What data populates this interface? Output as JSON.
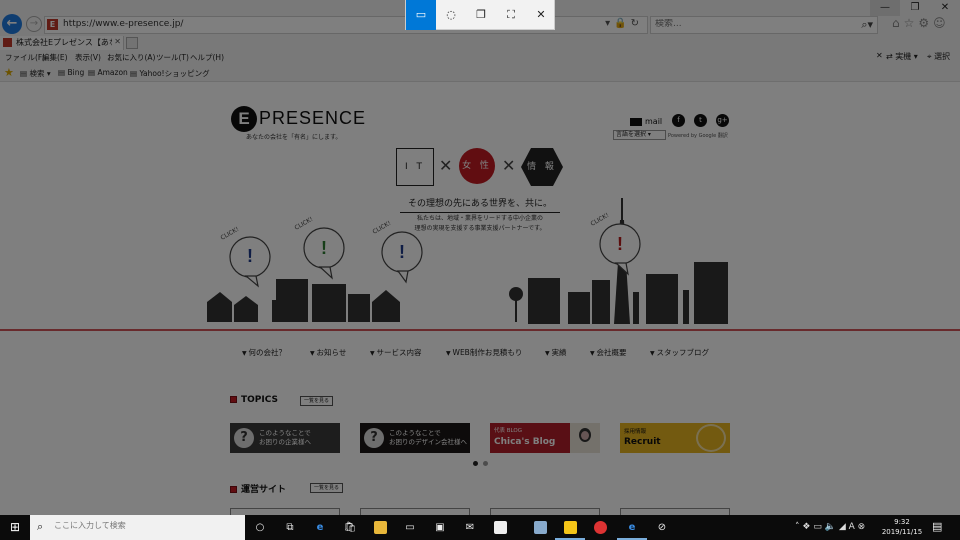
{
  "browser": {
    "url": "https://www.e-presence.jp/",
    "search_placeholder": "検索...",
    "tab_title": "株式会社Eプレゼンス【あなたの...",
    "menu": [
      "ファイル(F)",
      "編集(E)",
      "表示(V)",
      "お気に入り(A)",
      "ツール(T)",
      "ヘルプ(H)"
    ],
    "menu_right": [
      "実機",
      "選択"
    ],
    "favorites": [
      "検索",
      "Bing",
      "Amazon",
      "Yahoo!ショッピング"
    ]
  },
  "snip_toolbar": {
    "buttons": [
      {
        "name": "rectangular-snip",
        "icon": "▭",
        "active": true
      },
      {
        "name": "freeform-snip",
        "icon": "◌",
        "active": false
      },
      {
        "name": "window-snip",
        "icon": "❐",
        "active": false
      },
      {
        "name": "fullscreen-snip",
        "icon": "⛶",
        "active": false
      },
      {
        "name": "close",
        "icon": "✕",
        "active": false
      }
    ]
  },
  "site": {
    "logo_letter": "E",
    "logo_text": "PRESENCE",
    "logo_sub": "あなたの会社を「有名」にします。",
    "mail_label": "mail",
    "social": [
      "f",
      "t",
      "g+"
    ],
    "lang_select": "言語を選択",
    "powered_by": "Powered by Google 翻訳",
    "keywords": {
      "it": "I T",
      "woman": "女 性",
      "info": "情 報",
      "times": "✕"
    },
    "tagline": "その理想の先にある世界を、共に。",
    "description": [
      "私たちは、地域・業界をリードする中小企業の",
      "理想の実現を支援する事業支援パートナーです。"
    ],
    "click_label": "CLICK!",
    "nav": [
      "何の会社？",
      "お知らせ",
      "サービス内容",
      "WEB制作お見積もり",
      "実績",
      "会社概要",
      "スタッフブログ"
    ],
    "topics": {
      "title": "TOPICS",
      "more": "一覧を見る",
      "banners": [
        {
          "line1": "このようなことで",
          "line2": "お困りの企業様へ"
        },
        {
          "line1": "このようなことで",
          "line2": "お困りのデザイン会社様へ"
        },
        {
          "small": "代表 BLOG",
          "big": "Chica's Blog"
        },
        {
          "small": "採用情報",
          "big": "Recruit"
        }
      ]
    },
    "sites": {
      "title": "運営サイト",
      "more": "一覧を見る"
    }
  },
  "taskbar": {
    "search_placeholder": "ここに入力して検索",
    "time": "9:32",
    "date": "2019/11/15"
  },
  "colors": {
    "accent_red": "#c21b22",
    "snip_active": "#0078d7",
    "ie_blue": "#1e7be0"
  }
}
